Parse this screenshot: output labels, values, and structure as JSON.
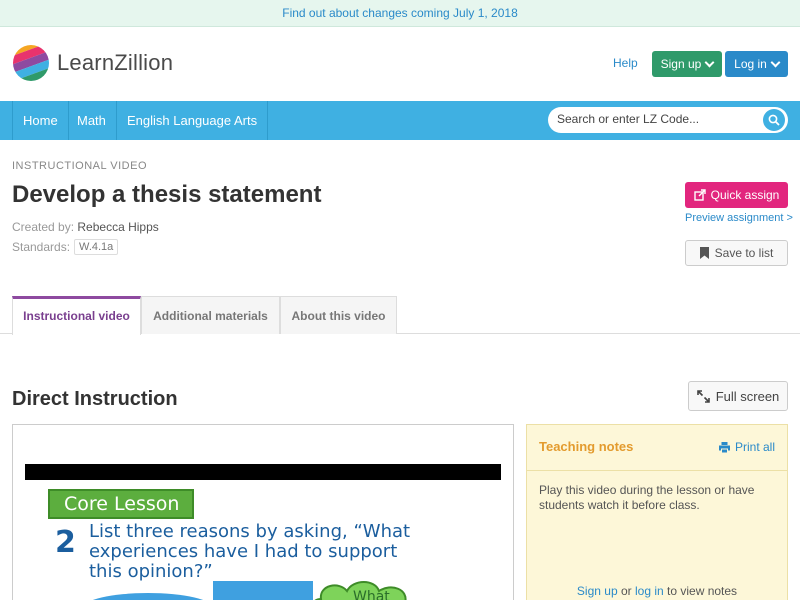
{
  "banner": {
    "text": "Find out about changes coming July 1, 2018"
  },
  "header": {
    "logo_text": "LearnZillion",
    "help": "Help",
    "signup": "Sign up",
    "login": "Log in"
  },
  "nav": {
    "items": [
      "Home",
      "Math",
      "English Language Arts"
    ],
    "search_placeholder": "Search or enter LZ Code..."
  },
  "page": {
    "eyebrow": "INSTRUCTIONAL VIDEO",
    "title": "Develop a thesis statement",
    "created_by_label": "Created by:",
    "created_by": "Rebecca Hipps",
    "standards_label": "Standards:",
    "standard": "W.4.1a",
    "quick_assign": "Quick assign",
    "preview_assignment": "Preview assignment >",
    "save_to_list": "Save to list"
  },
  "tabs": [
    "Instructional video",
    "Additional materials",
    "About this video"
  ],
  "section": {
    "title": "Direct Instruction",
    "full_screen": "Full screen"
  },
  "video": {
    "core_lesson": "Core Lesson",
    "step_number": "2",
    "step_text": "List three reasons by asking, “What experiences have I had to support this opinion?”",
    "cloud_text": "What"
  },
  "notes": {
    "title": "Teaching notes",
    "print": "Print all",
    "body": "Play this video during the lesson or have students watch it before class.",
    "signup": "Sign up",
    "or": "or",
    "login": "log in",
    "suffix": "to view notes"
  },
  "colors": {
    "nav_blue": "#3fb0e2",
    "signup_green": "#2f9a6a",
    "login_blue": "#2a8ac9",
    "quick_assign_pink": "#e2267e",
    "tab_active_purple": "#8e4aa0",
    "notes_title_orange": "#e39b2e"
  }
}
